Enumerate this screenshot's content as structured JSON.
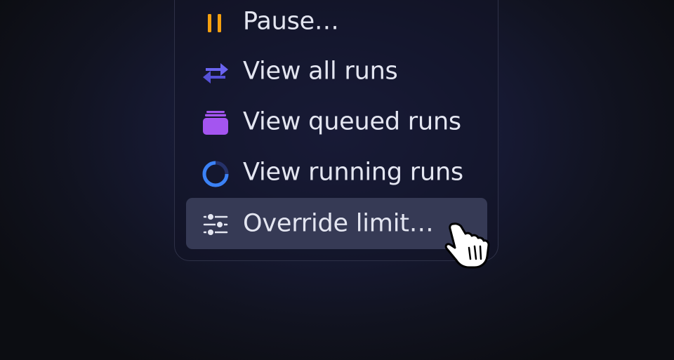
{
  "menu": {
    "items": [
      {
        "label": "Pause…",
        "icon": "pause-icon",
        "color": "#f5a00f"
      },
      {
        "label": "View all runs",
        "icon": "arrows-swap-icon",
        "color": "#6b64f0"
      },
      {
        "label": "View queued runs",
        "icon": "stack-icon",
        "color": "#a455f0"
      },
      {
        "label": "View running runs",
        "icon": "progress-ring-icon",
        "color": "#3b82f6"
      },
      {
        "label": "Override limit…",
        "icon": "sliders-icon",
        "color": "#e4e6f1",
        "active": true
      }
    ]
  },
  "colors": {
    "highlight": "#363a55",
    "text": "#e4e6f1",
    "border": "#2e3147"
  }
}
